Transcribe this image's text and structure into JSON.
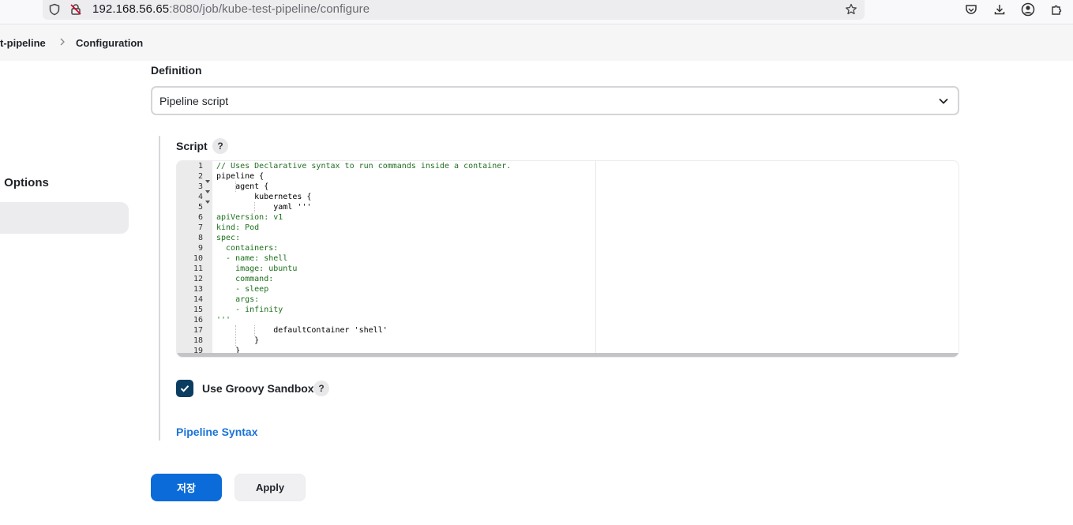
{
  "browser": {
    "url_host": "192.168.56.65",
    "url_path": ":8080/job/kube-test-pipeline/configure"
  },
  "breadcrumb": {
    "job": "t-pipeline",
    "current": "Configuration"
  },
  "sidebar": {
    "section_label": ": Options"
  },
  "definition": {
    "label": "Definition",
    "selected": "Pipeline script"
  },
  "script": {
    "label": "Script",
    "help": "?",
    "line_numbers": [
      "1",
      "2",
      "3",
      "4",
      "5",
      "6",
      "7",
      "8",
      "9",
      "10",
      "11",
      "12",
      "13",
      "14",
      "15",
      "16",
      "17",
      "18",
      "19"
    ],
    "lines": [
      "// Uses Declarative syntax to run commands inside a container.",
      "pipeline {",
      "    agent {",
      "        kubernetes {",
      "            yaml '''",
      "apiVersion: v1",
      "kind: Pod",
      "spec:",
      "  containers:",
      "  - name: shell",
      "    image: ubuntu",
      "    command:",
      "    - sleep",
      "    args:",
      "    - infinity",
      "'''",
      "            defaultContainer 'shell'",
      "        }",
      "    }"
    ]
  },
  "sandbox": {
    "label": "Use Groovy Sandbox",
    "checked": true,
    "help": "?"
  },
  "links": {
    "pipeline_syntax": "Pipeline Syntax"
  },
  "buttons": {
    "save": "저장",
    "apply": "Apply"
  }
}
